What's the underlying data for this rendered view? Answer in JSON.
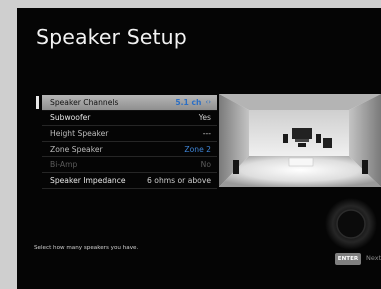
{
  "screen": {
    "title": "Speaker Setup"
  },
  "menu": {
    "items": [
      {
        "label": "Speaker Channels",
        "value": "5.1 ch"
      },
      {
        "label": "Subwoofer",
        "value": "Yes"
      },
      {
        "label": "Height Speaker",
        "value": "---"
      },
      {
        "label": "Zone Speaker",
        "value": "Zone 2"
      },
      {
        "label": "Bi-Amp",
        "value": "No"
      },
      {
        "label": "Speaker Impedance",
        "value": "6 ohms or above"
      }
    ]
  },
  "footer": {
    "hint": "Select how many speakers you have.",
    "enter_label": "ENTER",
    "next_label": "Next"
  },
  "colors": {
    "accent": "#3f86d8",
    "background": "#050505",
    "selection": "#a9a9a9"
  },
  "icons": [
    "left-right-arrows-icon",
    "speaker-icon",
    "subwoofer-icon",
    "tv-icon"
  ]
}
